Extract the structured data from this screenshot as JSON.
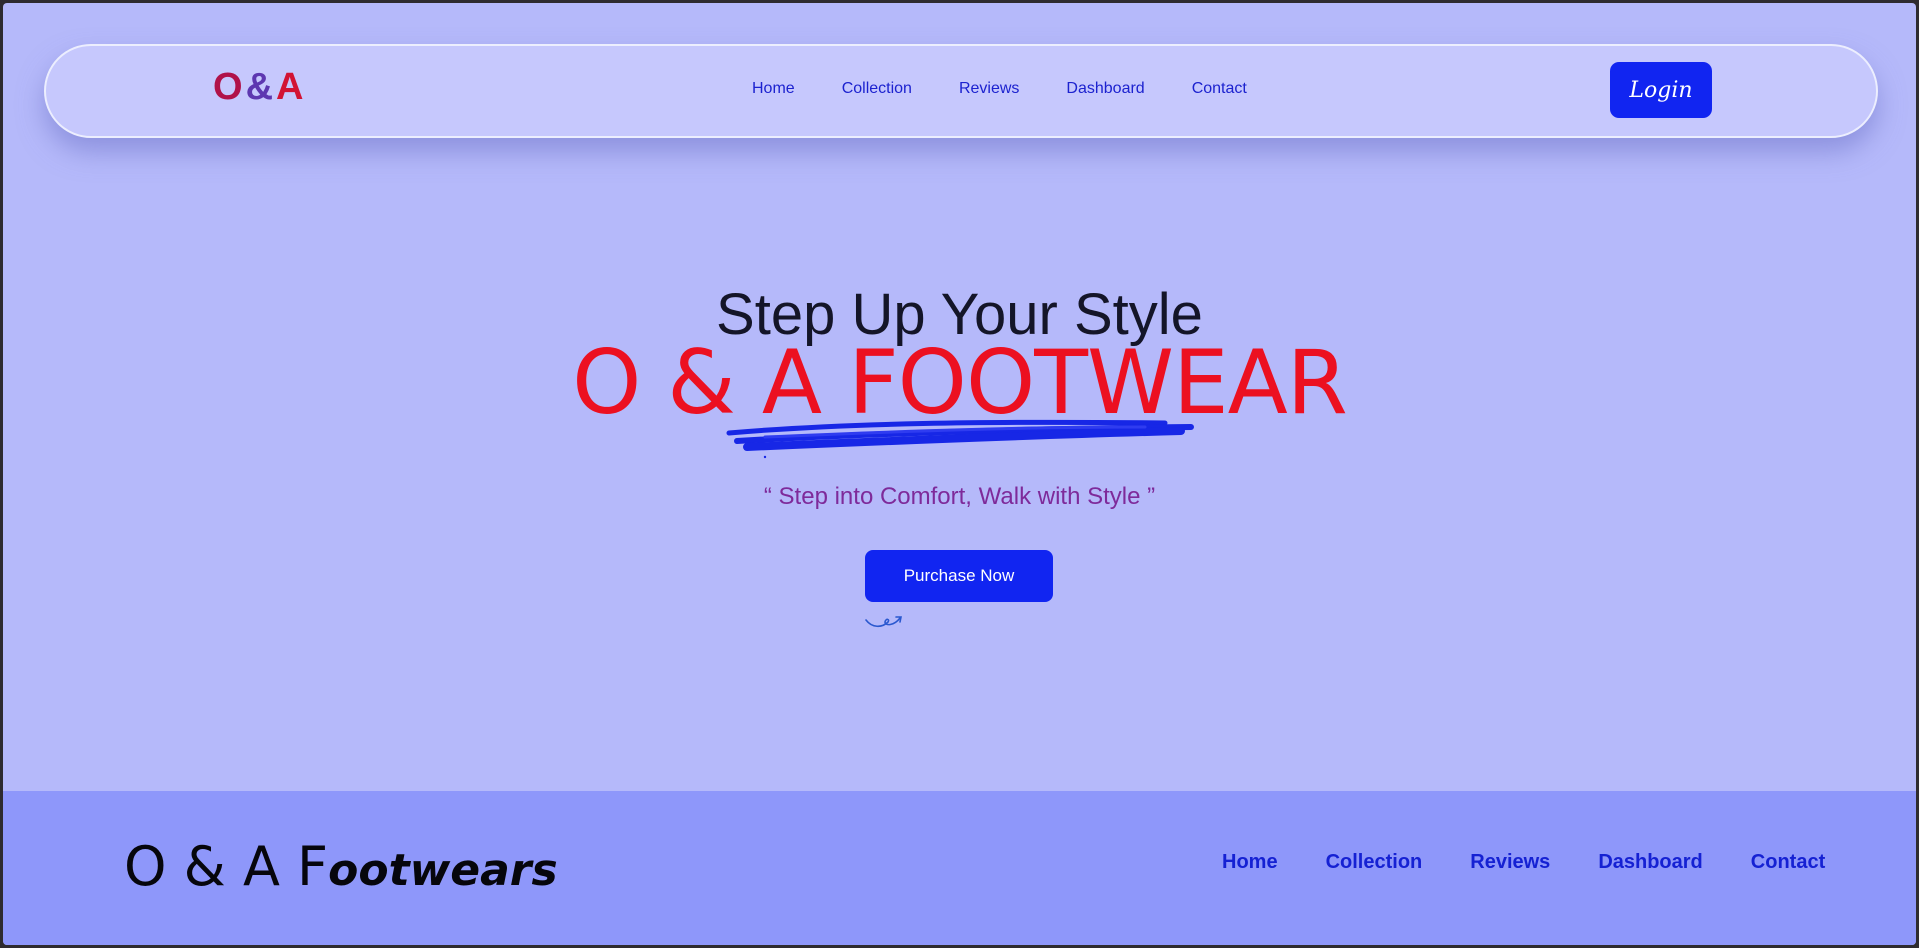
{
  "header": {
    "logo": {
      "o": "O",
      "amp": "&",
      "a": "A"
    },
    "nav": [
      "Home",
      "Collection",
      "Reviews",
      "Dashboard",
      "Contact"
    ],
    "login_label": "Login"
  },
  "hero": {
    "title": "Step Up Your Style",
    "brand": "O & A FOOTWEAR",
    "tagline": "“ Step into Comfort, Walk with Style ”",
    "cta_label": "Purchase Now"
  },
  "footer": {
    "brand_start": "O & A F",
    "brand_rest": "ootwears",
    "nav": [
      "Home",
      "Collection",
      "Reviews",
      "Dashboard",
      "Contact"
    ]
  },
  "colors": {
    "accent": "#1125f1",
    "brand_red": "#ec1020",
    "tagline": "#7e2a9a",
    "background": "#b5b9fa",
    "footer": "#8e97fa"
  }
}
